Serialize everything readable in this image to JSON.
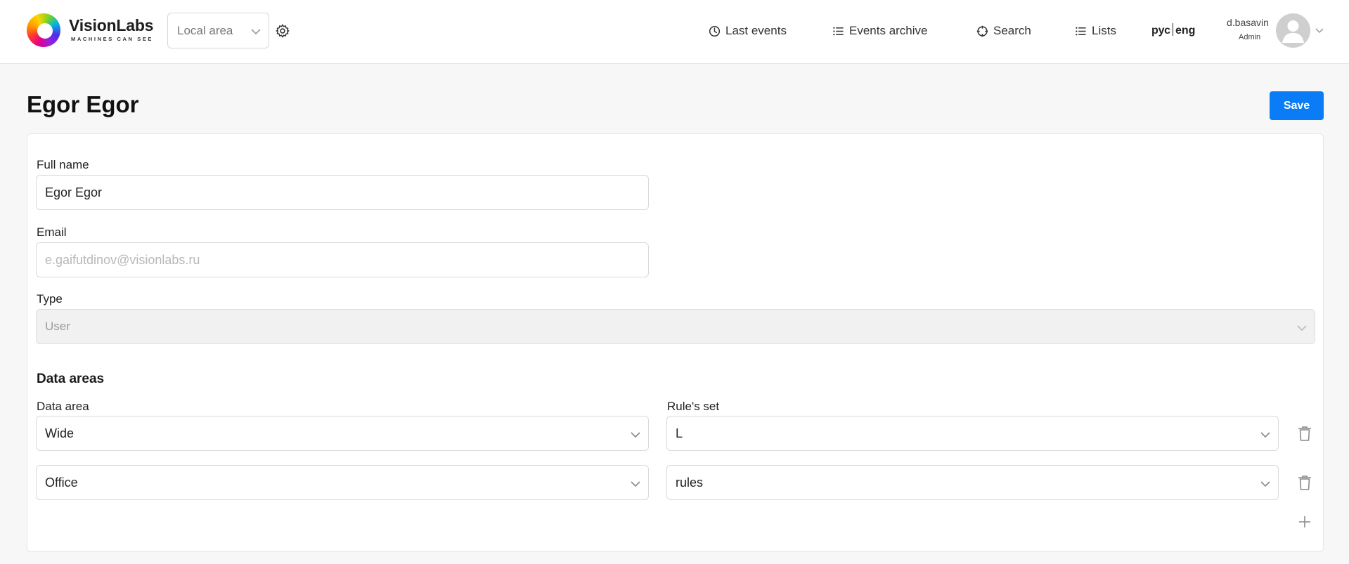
{
  "brand": {
    "name": "VisionLabs",
    "tagline": "MACHINES CAN SEE"
  },
  "header": {
    "area_select": {
      "value": "Local area"
    },
    "nav": [
      {
        "label": "Last events",
        "icon": "clock-icon"
      },
      {
        "label": "Events archive",
        "icon": "list-icon"
      },
      {
        "label": "Search",
        "icon": "crosshair-icon"
      },
      {
        "label": "Lists",
        "icon": "list-icon"
      }
    ],
    "lang": {
      "ru": "рус",
      "en": "eng"
    },
    "user": {
      "name": "d.basavin",
      "role": "Admin"
    }
  },
  "page": {
    "title": "Egor Egor",
    "save_label": "Save"
  },
  "form": {
    "full_name": {
      "label": "Full name",
      "value": "Egor Egor"
    },
    "email": {
      "label": "Email",
      "placeholder": "e.gaifutdinov@visionlabs.ru"
    },
    "type": {
      "label": "Type",
      "value": "User"
    },
    "data_areas": {
      "title": "Data areas",
      "col_area": "Data area",
      "col_rules": "Rule's set",
      "rows": [
        {
          "area": "Wide",
          "rules": "L"
        },
        {
          "area": "Office",
          "rules": "rules"
        }
      ]
    }
  },
  "colors": {
    "accent": "#0a7cf5",
    "background": "#f7f7f7",
    "card": "#ffffff",
    "border": "#d9d9d9"
  }
}
